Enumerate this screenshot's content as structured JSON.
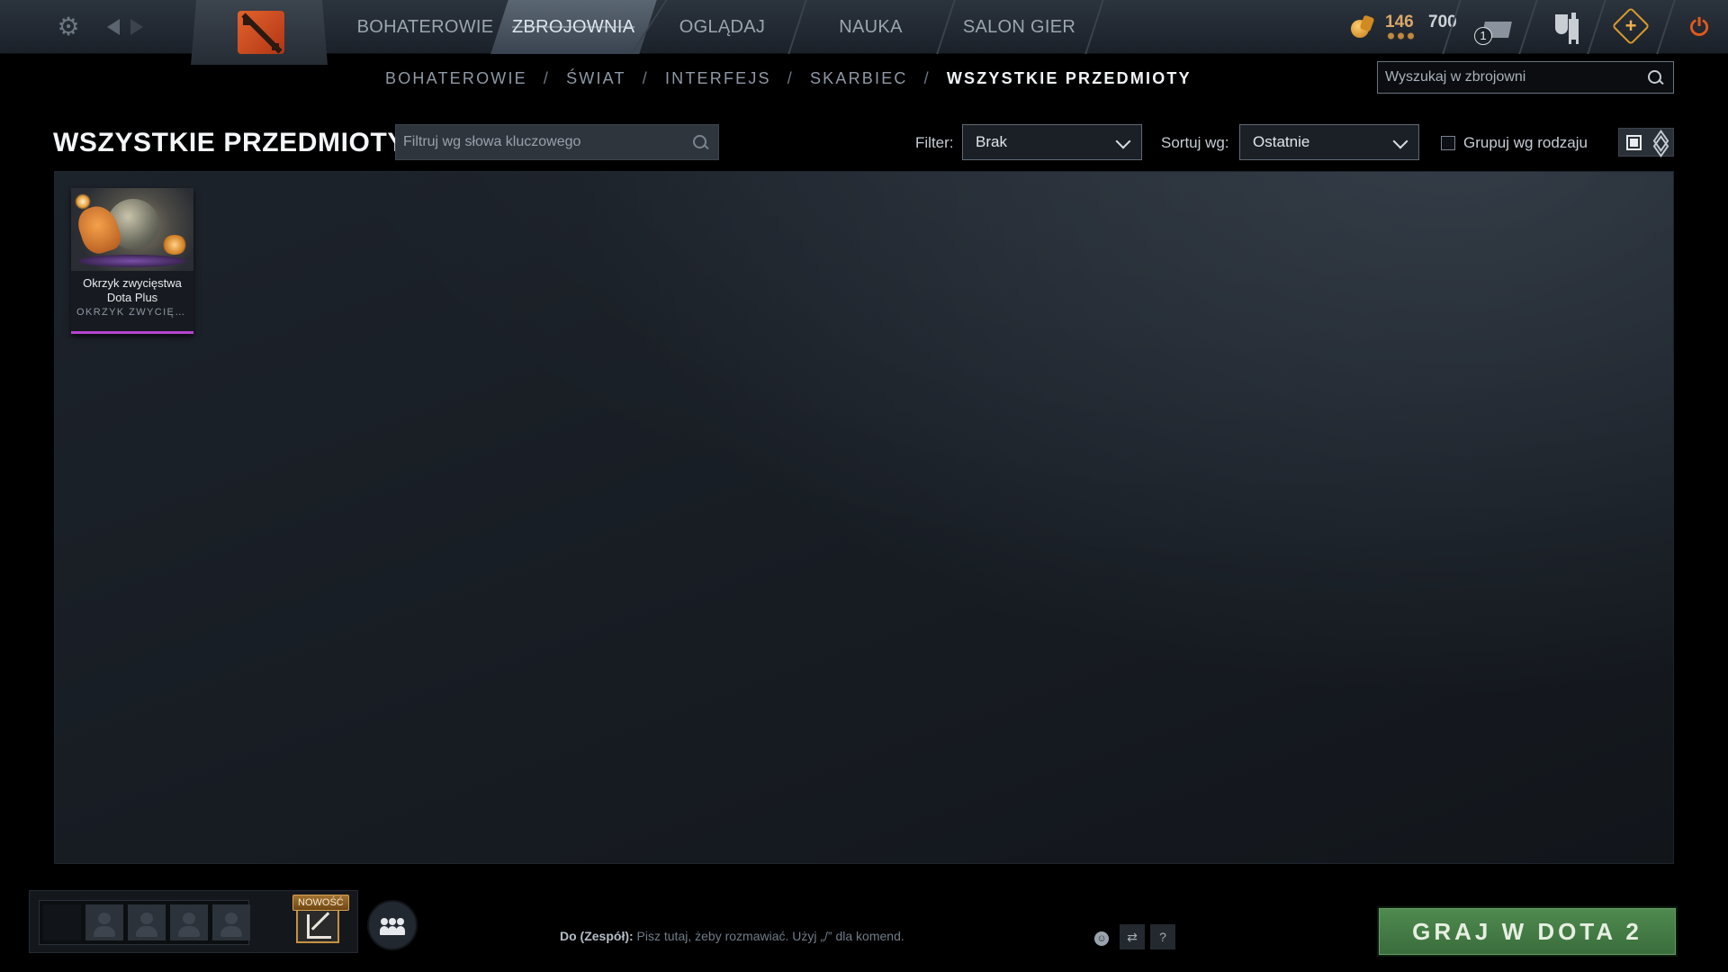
{
  "topbar": {
    "tabs": [
      {
        "label": "BOHATEROWIE"
      },
      {
        "label": "ZBROJOWNIA"
      },
      {
        "label": "OGLĄDAJ"
      },
      {
        "label": "NAUKA"
      },
      {
        "label": "SALON GIER"
      }
    ],
    "active_tab": "ZBROJOWNIA",
    "currency_value": "146",
    "secondary_value": "700",
    "mail_badge": "1",
    "icons": [
      "gear-icon",
      "back-arrow-icon",
      "forward-arrow-icon",
      "dota-logo",
      "coin-icon",
      "mail-icon",
      "armory-icon",
      "dota-plus-icon",
      "power-icon"
    ]
  },
  "breadcrumb": {
    "items": [
      "BOHATEROWIE",
      "ŚWIAT",
      "INTERFEJS",
      "SKARBIEC",
      "WSZYSTKIE PRZEDMIOTY"
    ],
    "separator": "/"
  },
  "search": {
    "placeholder": "Wyszukaj w zbrojowni"
  },
  "header": {
    "title": "WSZYSTKIE PRZEDMIOTY",
    "filter_placeholder": "Filtruj wg słowa kluczowego",
    "filter_label": "Filter:",
    "filter_value": "Brak",
    "sort_label": "Sortuj wg:",
    "sort_value": "Ostatnie",
    "group_label": "Grupuj wg rodzaju",
    "group_checked": false
  },
  "items": [
    {
      "name": "Okrzyk zwycięstwa Dota Plus",
      "type": "OKRZYK ZWYCIĘSTWA",
      "rarity_color": "#b844d0"
    }
  ],
  "bottom": {
    "new_badge": "NOWOŚĆ",
    "chat_to": "Do (Zespół):",
    "chat_hint": "Pisz tutaj, żeby rozmawiać. Użyj „/” dla komend.",
    "help": "?",
    "play_button": "GRAJ W DOTA 2"
  },
  "colors": {
    "accent_orange": "#e05a1c",
    "play_green": "#4f8a4f",
    "rarity_purple": "#b844d0"
  }
}
